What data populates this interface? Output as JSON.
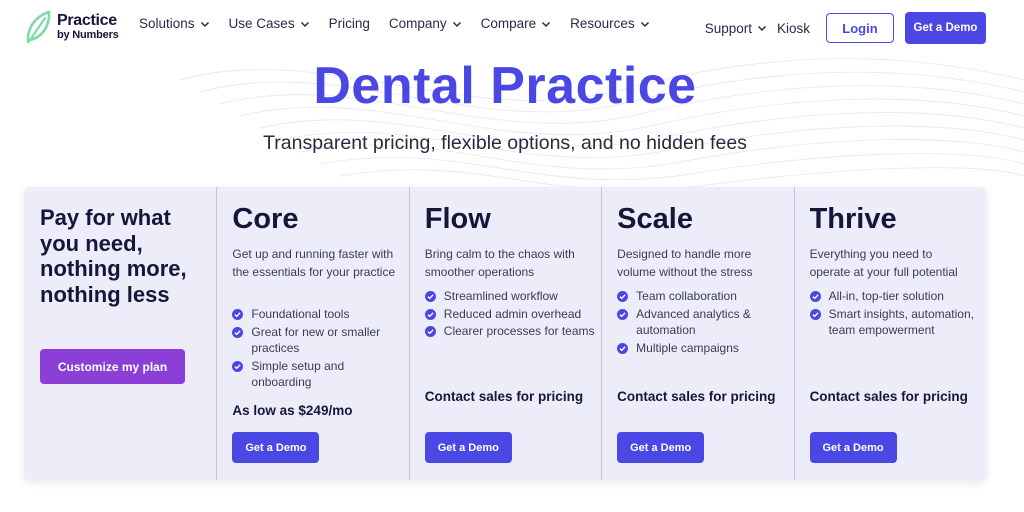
{
  "brand": {
    "line1": "Practice",
    "line2": "by Numbers",
    "accent": "#4b47e4",
    "accent_alt": "#8b3fd6",
    "logo_green": "#7fd9a8"
  },
  "nav": {
    "menu": [
      "Solutions",
      "Use Cases",
      "Pricing",
      "Company",
      "Compare",
      "Resources"
    ],
    "support": "Support",
    "kiosk": "Kiosk",
    "login": "Login",
    "demo": "Get a Demo"
  },
  "hero": {
    "title": "Dental Practice",
    "subtitle": "Transparent pricing, flexible options, and no hidden fees"
  },
  "intro": {
    "title": "Pay for what you need, nothing more, nothing less",
    "button": "Customize my plan"
  },
  "plans": [
    {
      "name": "Core",
      "description": "Get up and running faster with the essentials for your practice",
      "features": [
        "Foundational tools",
        "Great for new or smaller practices",
        "Simple setup and onboarding"
      ],
      "price": "As low as $249/mo",
      "button": "Get a Demo"
    },
    {
      "name": "Flow",
      "description": "Bring calm to the chaos with smoother operations",
      "features": [
        "Streamlined workflow",
        "Reduced admin overhead",
        "Clearer processes for teams"
      ],
      "price": "Contact sales for pricing",
      "button": "Get a Demo"
    },
    {
      "name": "Scale",
      "description": "Designed to handle more volume without the stress",
      "features": [
        "Team collaboration",
        "Advanced analytics & automation",
        "Multiple campaigns"
      ],
      "price": "Contact sales for pricing",
      "button": "Get a Demo"
    },
    {
      "name": "Thrive",
      "description": "Everything you need to operate at your full potential",
      "features": [
        "All-in, top-tier solution",
        "Smart insights, automation, team empowerment"
      ],
      "price": "Contact sales for pricing",
      "button": "Get a Demo"
    }
  ]
}
